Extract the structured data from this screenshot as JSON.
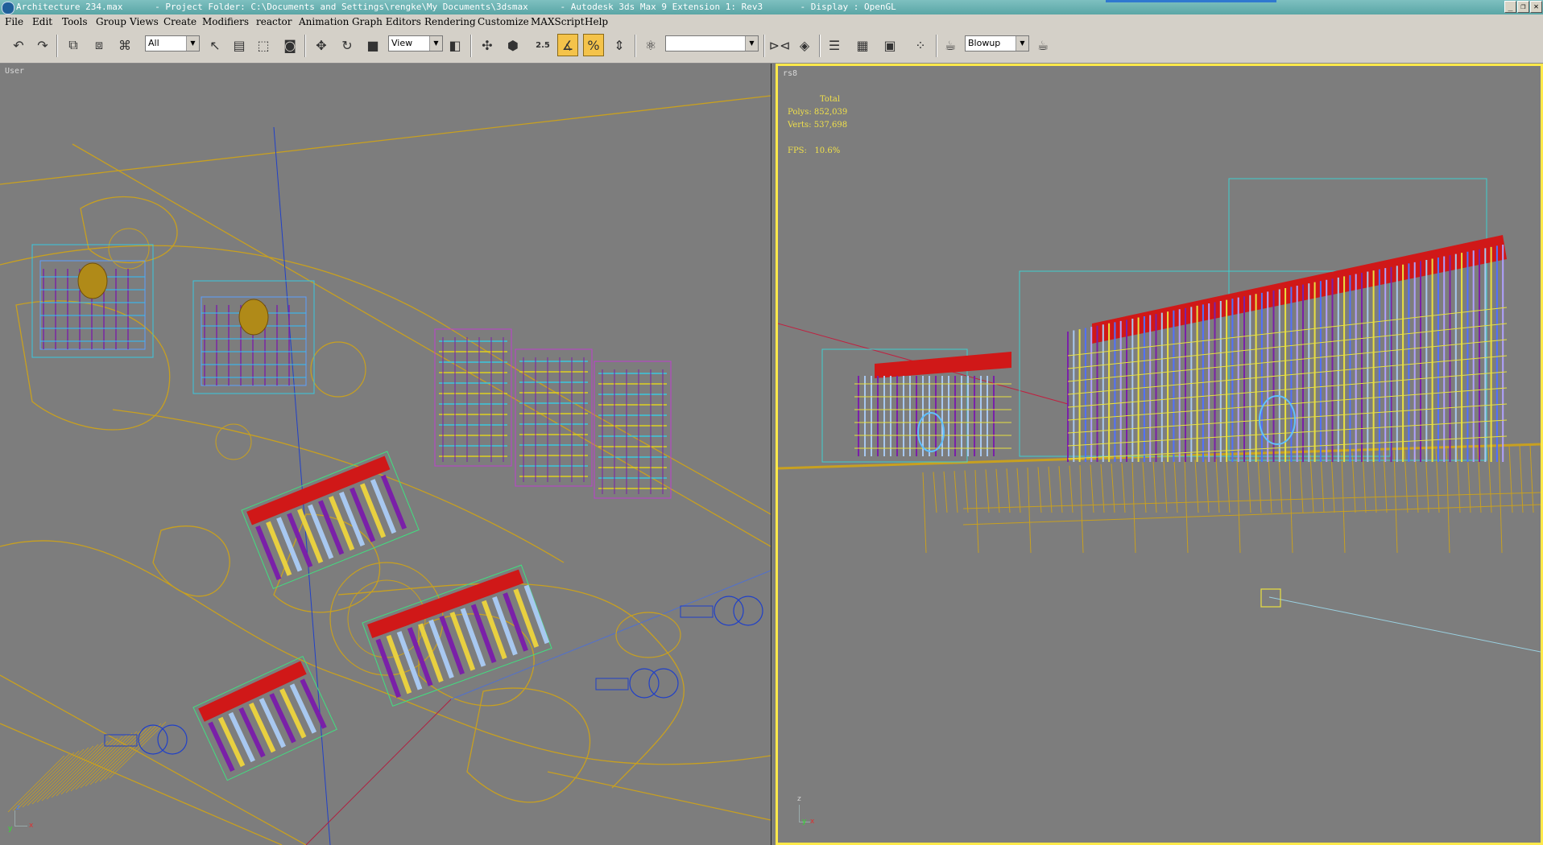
{
  "window": {
    "title": "Architecture 234.max      - Project Folder: C:\\Documents and Settings\\rengke\\My Documents\\3dsmax      - Autodesk 3ds Max 9 Extension 1: Rev3       - Display : OpenGL",
    "controls": [
      "_",
      "❐",
      "✕"
    ]
  },
  "menu": [
    "File",
    "Edit",
    "Tools",
    "Group",
    "Views",
    "Create",
    "Modifiers",
    "reactor",
    "Animation",
    "Graph Editors",
    "Rendering",
    "Customize",
    "MAXScript",
    "Help"
  ],
  "toolbar": {
    "selection_filter": "All",
    "reference_coord": "View",
    "named_selection": "",
    "render_preset": "Blowup",
    "snap_label": "2.5",
    "icons": [
      "undo-icon",
      "redo-icon",
      "link-icon",
      "unlink-icon",
      "bind-spacewarp-icon",
      "select-object-icon",
      "select-by-name-icon",
      "rect-region-icon",
      "window-crossing-icon",
      "move-icon",
      "rotate-icon",
      "scale-icon",
      "pivot-icon",
      "manipulate-icon",
      "keyboard-shortcut-icon",
      "snap-toggle-icon",
      "angle-snap-icon",
      "percent-snap-icon",
      "spinner-snap-icon",
      "edit-named-sets-icon",
      "mirror-icon",
      "align-icon",
      "layer-manager-icon",
      "curve-editor-icon",
      "schematic-view-icon",
      "material-editor-icon",
      "render-scene-icon",
      "quick-render-icon"
    ]
  },
  "colors": {
    "viewport_bg": "#7d7d7d",
    "active_border": "#ffe94a",
    "ground_lines": "#c8a020",
    "roof_red": "#d01818",
    "wire_cyan": "#39c8e0",
    "wire_purple": "#7a20a8",
    "wire_lightblue": "#a8c8f0",
    "camera_blue": "#2040c8"
  },
  "viewports": {
    "left": {
      "label": "User"
    },
    "right": {
      "label": "rs8",
      "stats": {
        "header": "Total",
        "polys_label": "Polys:",
        "polys_value": "852,039",
        "verts_label": "Verts:",
        "verts_value": "537,698",
        "fps_label": "FPS:",
        "fps_value": "10.6%"
      }
    }
  },
  "axis_labels": {
    "x": "x",
    "y": "y",
    "z": "z"
  }
}
